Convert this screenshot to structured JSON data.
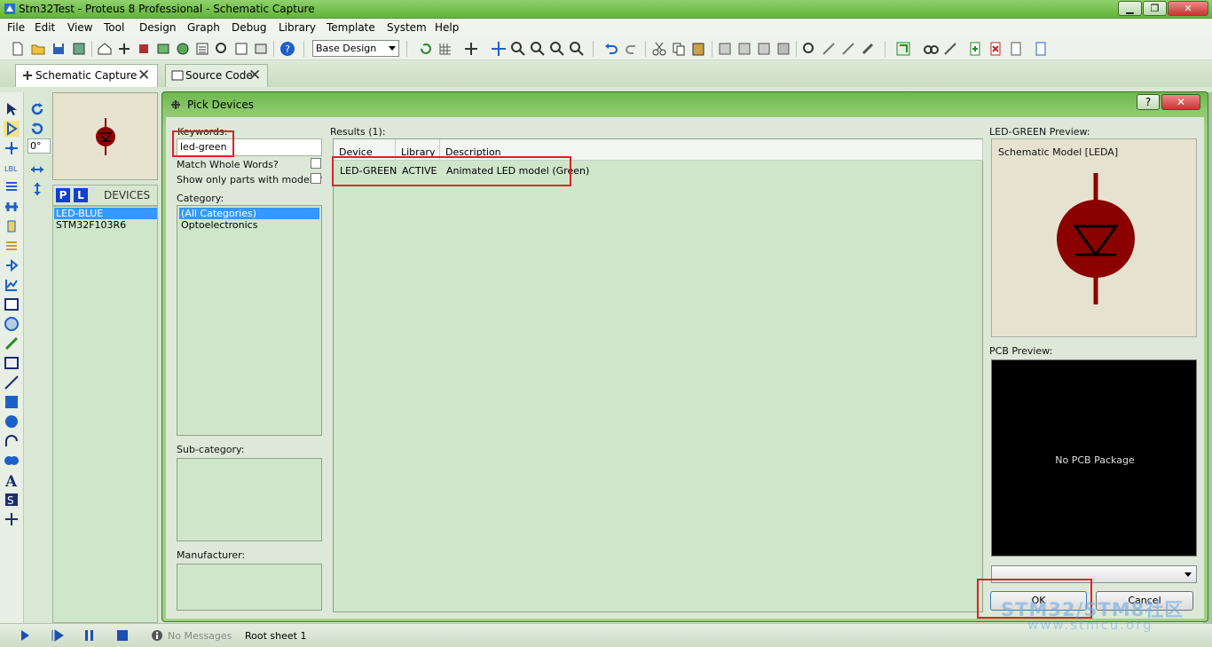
{
  "window": {
    "title": "Stm32Test - Proteus 8 Professional - Schematic Capture",
    "minimize": "▁",
    "maximize": "❐",
    "close": "✕"
  },
  "menu": [
    "File",
    "Edit",
    "View",
    "Tool",
    "Design",
    "Graph",
    "Debug",
    "Library",
    "Template",
    "System",
    "Help"
  ],
  "toolbar": {
    "design_combo_value": "Base Design"
  },
  "tabs": [
    {
      "label": "Schematic Capture",
      "close": "✕",
      "active": true
    },
    {
      "label": "Source Code",
      "close": "✕",
      "active": false
    }
  ],
  "left_panel": {
    "angle": "0°",
    "p_button": "P",
    "l_button": "L",
    "devices_label": "DEVICES",
    "devices": [
      "LED-BLUE",
      "STM32F103R6"
    ]
  },
  "dialog": {
    "title": "Pick Devices",
    "help_button": "?",
    "close_button": "✕",
    "keywords_label": "Keywords:",
    "keywords_value": "led-green",
    "match_whole_words_label": "Match Whole Words?",
    "show_only_models_label": "Show only parts with models?",
    "category_label": "Category:",
    "categories": [
      "(All Categories)",
      "Optoelectronics"
    ],
    "subcategory_label": "Sub-category:",
    "manufacturer_label": "Manufacturer:",
    "results_label": "Results (1):",
    "results_columns": [
      "Device",
      "Library",
      "Description"
    ],
    "results_rows": [
      {
        "device": "LED-GREEN",
        "library": "ACTIVE",
        "description": "Animated LED model (Green)"
      }
    ],
    "preview_label": "LED-GREEN Preview:",
    "schematic_model": "Schematic Model [LEDA]",
    "pcb_preview_label": "PCB Preview:",
    "no_pcb_package": "No PCB Package",
    "ok_button": "OK",
    "cancel_button": "Cancel"
  },
  "statusbar": {
    "messages": "No Messages",
    "sheet": "Root sheet 1"
  },
  "watermark": {
    "line1": "STM32/STM8社区",
    "line2": "www.stmcu.org"
  },
  "colors": {
    "accent_green": "#62b43a",
    "highlight_red": "#e0202a",
    "selection_blue": "#3399ff",
    "led_dark_red": "#8b0000"
  }
}
